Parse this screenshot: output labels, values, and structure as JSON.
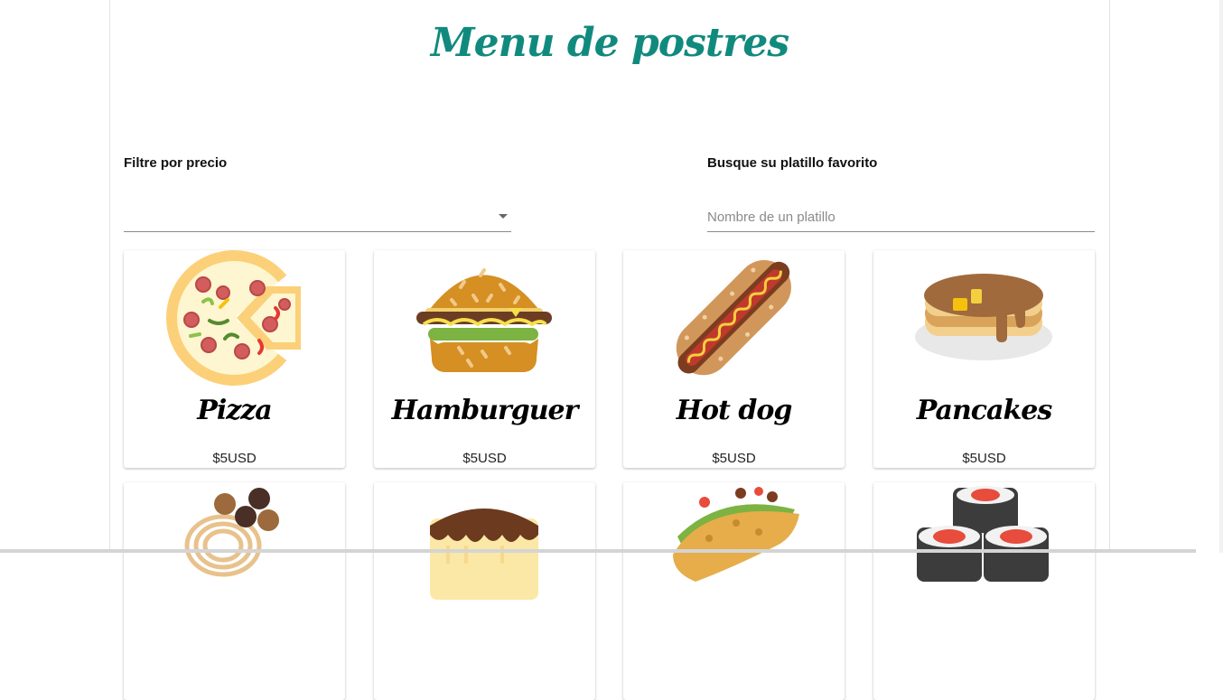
{
  "header": {
    "title": "Menu de postres"
  },
  "filters": {
    "price_label": "Filtre por precio",
    "price_value": "",
    "search_label": "Busque su platillo favorito",
    "search_placeholder": "Nombre de un platillo",
    "search_value": ""
  },
  "colors": {
    "title": "#118a7e"
  },
  "dishes": [
    {
      "name": "Pizza",
      "price": "$5USD",
      "icon": "pizza-icon"
    },
    {
      "name": "Hamburguer",
      "price": "$5USD",
      "icon": "hamburger-icon"
    },
    {
      "name": "Hot dog",
      "price": "$5USD",
      "icon": "hotdog-icon"
    },
    {
      "name": "Pancakes",
      "price": "$5USD",
      "icon": "pancakes-icon"
    },
    {
      "name": "",
      "price": "",
      "icon": "spaghetti-icon"
    },
    {
      "name": "",
      "price": "",
      "icon": "cake-icon"
    },
    {
      "name": "",
      "price": "",
      "icon": "taco-icon"
    },
    {
      "name": "",
      "price": "",
      "icon": "sushi-icon"
    }
  ]
}
